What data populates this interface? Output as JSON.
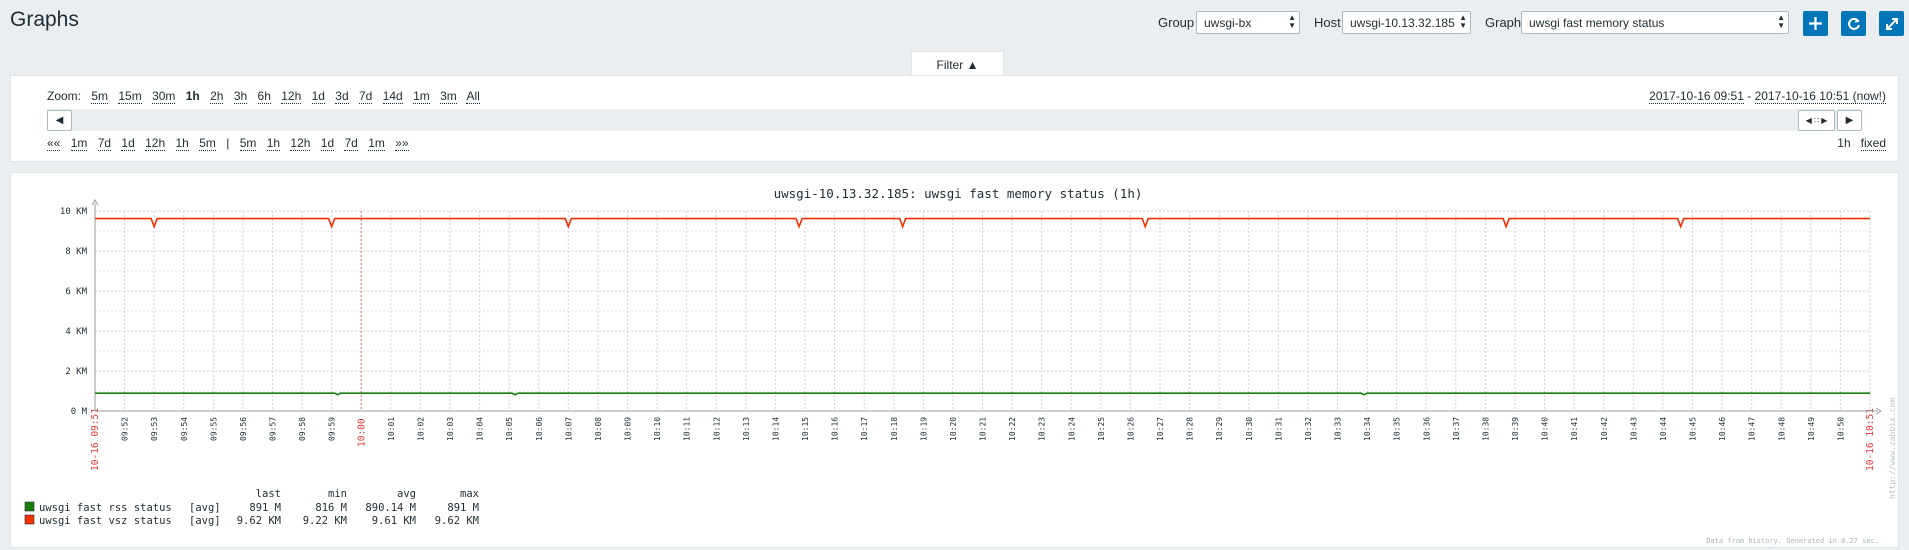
{
  "header": {
    "title": "Graphs",
    "group_label": "Group",
    "group_value": "uwsgi-bx",
    "host_label": "Host",
    "host_value": "uwsgi-10.13.32.185",
    "graph_label": "Graph",
    "graph_value": "uwsgi fast memory status",
    "accent_color": "#0275b8",
    "buttons": [
      "plus-icon",
      "refresh-icon",
      "fullscreen-icon"
    ]
  },
  "filter": {
    "tab_label": "Filter",
    "zoom_label": "Zoom:",
    "zoom_options": [
      "5m",
      "15m",
      "30m",
      "1h",
      "2h",
      "3h",
      "6h",
      "12h",
      "1d",
      "3d",
      "7d",
      "14d",
      "1m",
      "3m",
      "All"
    ],
    "zoom_active": "1h",
    "period_from": "2017-10-16 09:51",
    "period_sep": " - ",
    "period_to": "2017-10-16 10:51 (now!)",
    "nav_back_start": "««",
    "nav_back": [
      "1m",
      "7d",
      "1d",
      "12h",
      "1h",
      "5m"
    ],
    "nav_sep": "|",
    "nav_forward": [
      "5m",
      "1h",
      "12h",
      "1d",
      "7d",
      "1m"
    ],
    "nav_forward_end": "»»",
    "period_length": "1h",
    "fixed_label": "fixed"
  },
  "chart_data": {
    "type": "line",
    "title": "uwsgi-10.13.32.185: uwsgi fast memory status (1h)",
    "y_ticks": [
      "0 M",
      "2 KM",
      "4 KM",
      "6 KM",
      "8 KM",
      "10 KM"
    ],
    "ylim": [
      0,
      10000
    ],
    "y_unit": "M",
    "x_start_label": "10-16 09:51",
    "x_mid_label": "10:00",
    "x_end_label": "10-16 10:51",
    "x_ticks": [
      "09:52",
      "09:53",
      "09:54",
      "09:55",
      "09:56",
      "09:57",
      "09:58",
      "09:59",
      "10:00",
      "10:01",
      "10:02",
      "10:03",
      "10:04",
      "10:05",
      "10:06",
      "10:07",
      "10:08",
      "10:09",
      "10:10",
      "10:11",
      "10:12",
      "10:13",
      "10:14",
      "10:15",
      "10:16",
      "10:17",
      "10:18",
      "10:19",
      "10:20",
      "10:21",
      "10:22",
      "10:23",
      "10:24",
      "10:25",
      "10:26",
      "10:27",
      "10:28",
      "10:29",
      "10:30",
      "10:31",
      "10:32",
      "10:33",
      "10:34",
      "10:35",
      "10:36",
      "10:37",
      "10:38",
      "10:39",
      "10:40",
      "10:41",
      "10:42",
      "10:43",
      "10:44",
      "10:45",
      "10:46",
      "10:47",
      "10:48",
      "10:49",
      "10:50",
      "10:51"
    ],
    "grid": true,
    "series": [
      {
        "name": "uwsgi fast rss status",
        "func": "[avg]",
        "color": "#1a7c11",
        "last": "891 M",
        "min": "816 M",
        "avg": "890.14 M",
        "max": "891 M",
        "baseline": 891,
        "dips_at_minute": [
          8.2,
          14.2,
          42.9
        ],
        "dip_value": 816
      },
      {
        "name": "uwsgi fast vsz status",
        "func": "[avg]",
        "color": "#f63100",
        "last": "9.62 KM",
        "min": "9.22 KM",
        "avg": "9.61 KM",
        "max": "9.62 KM",
        "baseline": 9620,
        "dips_at_minute": [
          2.0,
          8.0,
          16.0,
          23.8,
          27.3,
          35.5,
          47.7,
          53.6
        ],
        "dip_value": 9220
      }
    ],
    "legend_headers": [
      "last",
      "min",
      "avg",
      "max"
    ],
    "watermark": "http://www.zabbix.com",
    "footer_note": "Data from history. Generated in 0.27 sec."
  }
}
